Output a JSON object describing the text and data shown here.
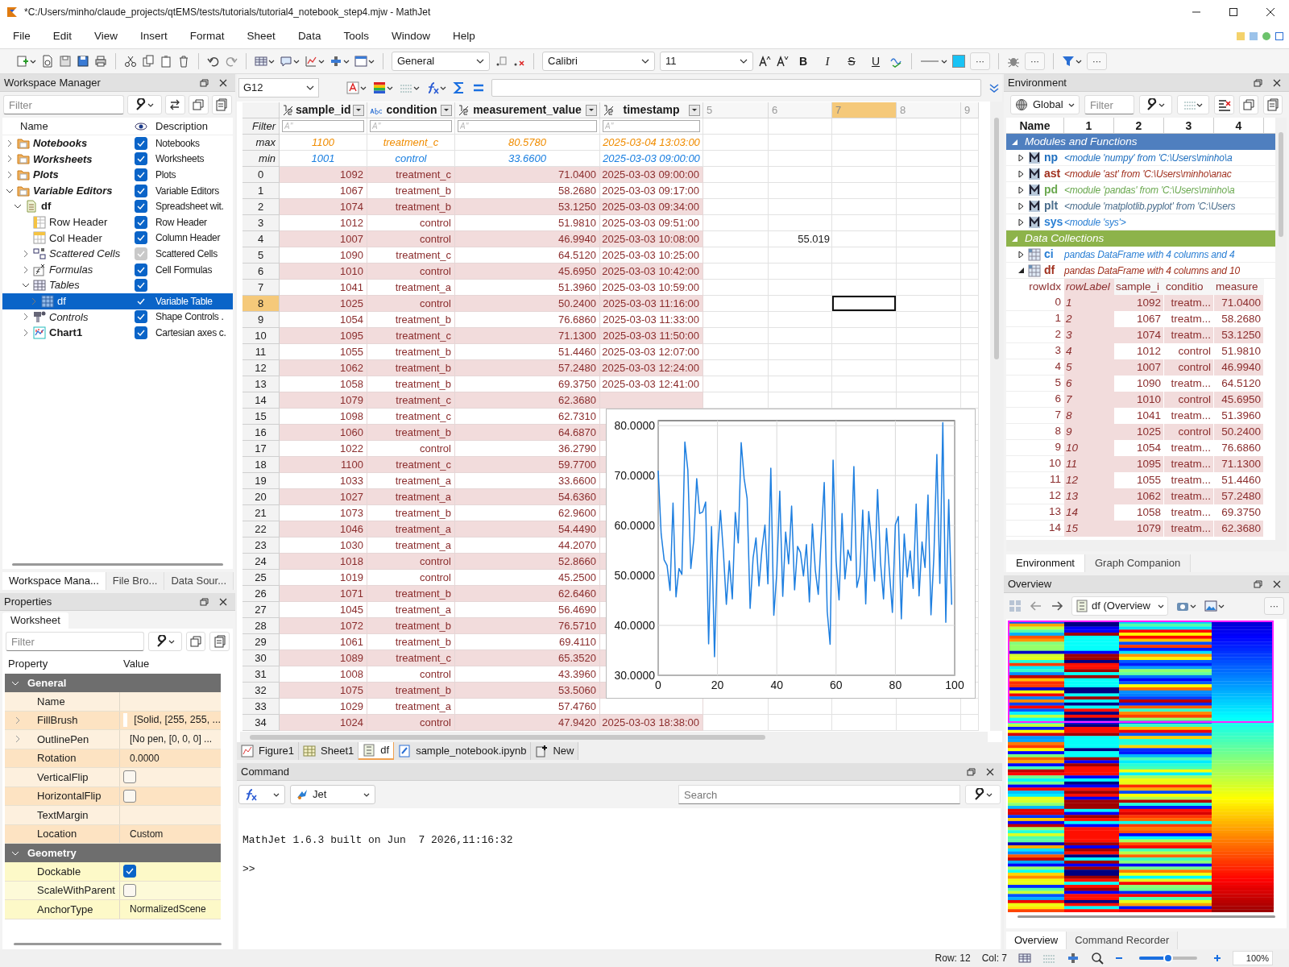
{
  "window": {
    "title": "*C:/Users/minho/claude_projects/qtEMS/tests/tutorials/tutorial4_notebook_step4.mjw - MathJet"
  },
  "menu": [
    "File",
    "Edit",
    "View",
    "Insert",
    "Format",
    "Sheet",
    "Data",
    "Tools",
    "Window",
    "Help"
  ],
  "toolbar": {
    "number_format": "General",
    "font": "Calibri",
    "font_size": "11",
    "format_buttons": [
      "B",
      "I",
      "S",
      "U"
    ],
    "more_buttons": [
      "···",
      "···",
      "···"
    ]
  },
  "workspace_manager": {
    "title": "Workspace Manager",
    "filter_placeholder": "Filter",
    "columns": [
      "Name",
      "Description"
    ],
    "tree": [
      {
        "name": "Notebooks",
        "kind": "folder",
        "expanded": false,
        "checked": true,
        "disabled": false,
        "selected": false,
        "description": "Notebooks"
      },
      {
        "name": "Worksheets",
        "kind": "folder",
        "expanded": false,
        "checked": true,
        "disabled": false,
        "selected": false,
        "description": "Worksheets"
      },
      {
        "name": "Plots",
        "kind": "folder",
        "expanded": false,
        "checked": true,
        "disabled": false,
        "selected": false,
        "description": "Plots"
      },
      {
        "name": "Variable Editors",
        "kind": "folder",
        "expanded": true,
        "checked": true,
        "disabled": false,
        "selected": false,
        "description": "Variable Editors",
        "children": [
          {
            "name": "df",
            "kind": "spreadsheet",
            "expanded": true,
            "checked": true,
            "disabled": false,
            "selected": false,
            "description": "Spreadsheet wit.",
            "children": [
              {
                "name": "Row Header",
                "kind": "row-header",
                "checked": true,
                "disabled": false,
                "selected": false,
                "description": "Row Header"
              },
              {
                "name": "Col Header",
                "kind": "col-header",
                "checked": true,
                "disabled": false,
                "selected": false,
                "description": "Column Header"
              },
              {
                "name": "Scattered Cells",
                "kind": "scatter",
                "expanded": false,
                "checked": true,
                "disabled": true,
                "selected": false,
                "description": "Scattered Cells"
              },
              {
                "name": "Formulas",
                "kind": "formula",
                "expanded": false,
                "checked": true,
                "disabled": false,
                "selected": false,
                "description": "Cell Formulas"
              },
              {
                "name": "Tables",
                "kind": "table",
                "expanded": true,
                "checked": true,
                "disabled": false,
                "selected": false,
                "children": [
                  {
                    "name": "df",
                    "kind": "table-blue",
                    "expanded": false,
                    "checked": true,
                    "disabled": false,
                    "selected": true,
                    "description": "Variable Table"
                  }
                ]
              },
              {
                "name": "Controls",
                "kind": "controls",
                "expanded": false,
                "checked": true,
                "disabled": false,
                "selected": false,
                "description": "Shape Controls ."
              },
              {
                "name": "Chart1",
                "kind": "chart",
                "expanded": false,
                "checked": true,
                "disabled": false,
                "selected": false,
                "description": "Cartesian axes c."
              }
            ]
          }
        ]
      }
    ],
    "tabs": [
      {
        "label": "Workspace Mana...",
        "selected": true
      },
      {
        "label": "File Bro...",
        "selected": false
      },
      {
        "label": "Data Sour...",
        "selected": false
      }
    ]
  },
  "properties": {
    "title": "Properties",
    "tab": "Worksheet",
    "filter_placeholder": "Filter",
    "columns": [
      "Property",
      "Value"
    ],
    "groups": [
      {
        "title": "General",
        "expanded": true,
        "rows": [
          {
            "name": "Name",
            "kind": "text",
            "expandable": false
          },
          {
            "name": "FillBrush",
            "kind": "color",
            "color": "#ffffff",
            "value": "[Solid, [255, 255, ...",
            "expandable": true
          },
          {
            "name": "OutlinePen",
            "kind": "text",
            "value": "[No pen, [0, 0, 0] ...",
            "expandable": true
          },
          {
            "name": "Rotation",
            "kind": "text",
            "value": "0.0000",
            "expandable": false
          },
          {
            "name": "VerticalFlip",
            "kind": "checkbox",
            "checked": false,
            "expandable": false
          },
          {
            "name": "HorizontalFlip",
            "kind": "checkbox",
            "checked": false,
            "expandable": false
          },
          {
            "name": "TextMargin",
            "kind": "text",
            "expandable": false
          },
          {
            "name": "Location",
            "kind": "text",
            "value": "Custom",
            "expandable": false
          }
        ]
      },
      {
        "title": "Geometry",
        "expanded": true,
        "rows": [
          {
            "name": "Dockable",
            "kind": "checkbox",
            "checked": true,
            "expandable": false
          },
          {
            "name": "ScaleWithParent",
            "kind": "checkbox",
            "checked": false,
            "expandable": false
          },
          {
            "name": "AnchorType",
            "kind": "text",
            "value": "NormalizedScene",
            "expandable": false
          }
        ]
      }
    ]
  },
  "sheet": {
    "cell_ref": "G12",
    "columns": [
      {
        "label": "sample_id",
        "kind": "number",
        "selected": false
      },
      {
        "label": "condition",
        "kind": "text",
        "selected": false
      },
      {
        "label": "measurement_value",
        "kind": "number",
        "selected": false
      },
      {
        "label": "timestamp",
        "kind": "number",
        "selected": false
      },
      {
        "label": "5",
        "kind": "empty",
        "selected": false
      },
      {
        "label": "6",
        "kind": "empty",
        "selected": false
      },
      {
        "label": "7",
        "kind": "empty",
        "selected": true
      },
      {
        "label": "8",
        "kind": "empty",
        "selected": false
      },
      {
        "label": "9",
        "kind": "empty",
        "selected": false
      }
    ],
    "filter_label": "Filter",
    "filter_placeholders": [
      "A''",
      "A''",
      "A''",
      "A''"
    ],
    "stats": [
      {
        "label": "max",
        "kind": "max",
        "values": [
          "1100",
          "treatment_c",
          "80.5780",
          "2025-03-04 13:03:00"
        ]
      },
      {
        "label": "min",
        "kind": "min",
        "values": [
          "1001",
          "control",
          "33.6600",
          "2025-03-03 09:00:00"
        ]
      }
    ],
    "rows": [
      {
        "index": "0",
        "selected": false,
        "values": [
          "1092",
          "treatment_c",
          "71.0400",
          "2025-03-03 09:00:00"
        ]
      },
      {
        "index": "1",
        "selected": false,
        "values": [
          "1067",
          "treatment_b",
          "58.2680",
          "2025-03-03 09:17:00"
        ]
      },
      {
        "index": "2",
        "selected": false,
        "values": [
          "1074",
          "treatment_b",
          "53.1250",
          "2025-03-03 09:34:00"
        ]
      },
      {
        "index": "3",
        "selected": false,
        "values": [
          "1012",
          "control",
          "51.9810",
          "2025-03-03 09:51:00"
        ]
      },
      {
        "index": "4",
        "selected": false,
        "values": [
          "1007",
          "control",
          "46.9940",
          "2025-03-03 10:08:00"
        ],
        "column_6": "55.019"
      },
      {
        "index": "5",
        "selected": false,
        "values": [
          "1090",
          "treatment_c",
          "64.5120",
          "2025-03-03 10:25:00"
        ]
      },
      {
        "index": "6",
        "selected": false,
        "values": [
          "1010",
          "control",
          "45.6950",
          "2025-03-03 10:42:00"
        ]
      },
      {
        "index": "7",
        "selected": false,
        "values": [
          "1041",
          "treatment_a",
          "51.3960",
          "2025-03-03 10:59:00"
        ]
      },
      {
        "index": "8",
        "selected": true,
        "values": [
          "1025",
          "control",
          "50.2400",
          "2025-03-03 11:16:00"
        ]
      },
      {
        "index": "9",
        "selected": false,
        "values": [
          "1054",
          "treatment_b",
          "76.6860",
          "2025-03-03 11:33:00"
        ]
      },
      {
        "index": "10",
        "selected": false,
        "values": [
          "1095",
          "treatment_c",
          "71.1300",
          "2025-03-03 11:50:00"
        ]
      },
      {
        "index": "11",
        "selected": false,
        "values": [
          "1055",
          "treatment_b",
          "51.4460",
          "2025-03-03 12:07:00"
        ]
      },
      {
        "index": "12",
        "selected": false,
        "values": [
          "1062",
          "treatment_b",
          "57.2480",
          "2025-03-03 12:24:00"
        ]
      },
      {
        "index": "13",
        "selected": false,
        "values": [
          "1058",
          "treatment_b",
          "69.3750",
          "2025-03-03 12:41:00"
        ]
      },
      {
        "index": "14",
        "selected": false,
        "values": [
          "1079",
          "treatment_c",
          "62.3680"
        ]
      },
      {
        "index": "15",
        "selected": false,
        "values": [
          "1098",
          "treatment_c",
          "62.7310"
        ]
      },
      {
        "index": "16",
        "selected": false,
        "values": [
          "1060",
          "treatment_b",
          "64.6870"
        ]
      },
      {
        "index": "17",
        "selected": false,
        "values": [
          "1022",
          "control",
          "36.2790"
        ]
      },
      {
        "index": "18",
        "selected": false,
        "values": [
          "1100",
          "treatment_c",
          "59.7700"
        ]
      },
      {
        "index": "19",
        "selected": false,
        "values": [
          "1033",
          "treatment_a",
          "33.6600"
        ]
      },
      {
        "index": "20",
        "selected": false,
        "values": [
          "1027",
          "treatment_a",
          "54.6360"
        ]
      },
      {
        "index": "21",
        "selected": false,
        "values": [
          "1073",
          "treatment_b",
          "62.9600"
        ]
      },
      {
        "index": "22",
        "selected": false,
        "values": [
          "1046",
          "treatment_a",
          "54.4490"
        ]
      },
      {
        "index": "23",
        "selected": false,
        "values": [
          "1030",
          "treatment_a",
          "44.2070"
        ]
      },
      {
        "index": "24",
        "selected": false,
        "values": [
          "1018",
          "control",
          "52.8660"
        ]
      },
      {
        "index": "25",
        "selected": false,
        "values": [
          "1019",
          "control",
          "45.2500"
        ]
      },
      {
        "index": "26",
        "selected": false,
        "values": [
          "1071",
          "treatment_b",
          "62.6460"
        ]
      },
      {
        "index": "27",
        "selected": false,
        "values": [
          "1045",
          "treatment_a",
          "56.4690"
        ]
      },
      {
        "index": "28",
        "selected": false,
        "values": [
          "1072",
          "treatment_b",
          "76.5710"
        ]
      },
      {
        "index": "29",
        "selected": false,
        "values": [
          "1061",
          "treatment_b",
          "69.4110"
        ]
      },
      {
        "index": "30",
        "selected": false,
        "values": [
          "1089",
          "treatment_c",
          "65.3520"
        ]
      },
      {
        "index": "31",
        "selected": false,
        "values": [
          "1008",
          "control",
          "43.3960"
        ]
      },
      {
        "index": "32",
        "selected": false,
        "values": [
          "1075",
          "treatment_b",
          "53.5060"
        ]
      },
      {
        "index": "33",
        "selected": false,
        "values": [
          "1029",
          "treatment_a",
          "57.4760"
        ]
      },
      {
        "index": "34",
        "selected": false,
        "values": [
          "1024",
          "control",
          "47.9420",
          "2025-03-03 18:38:00"
        ]
      }
    ],
    "chart": {
      "chart_data": {
        "type": "line",
        "xlim": [
          0,
          100
        ],
        "ylim": [
          30,
          81
        ],
        "grid": true,
        "x": [
          0,
          1,
          2,
          3,
          4,
          5,
          6,
          7,
          8,
          9,
          10,
          11,
          12,
          13,
          14,
          15,
          16,
          17,
          18,
          19,
          20,
          21,
          22,
          23,
          24,
          25,
          26,
          27,
          28,
          29,
          30,
          31,
          32,
          33,
          34,
          35,
          36,
          37,
          38,
          39,
          40,
          41,
          42,
          43,
          44,
          45,
          46,
          47,
          48,
          49,
          50,
          51,
          52,
          53,
          54,
          55,
          56,
          57,
          58,
          59,
          60,
          61,
          62,
          63,
          64,
          65,
          66,
          67,
          68,
          69,
          70,
          71,
          72,
          73,
          74,
          75,
          76,
          77,
          78,
          79,
          80,
          81,
          82,
          83,
          84,
          85,
          86,
          87,
          88,
          89,
          90,
          91,
          92,
          93,
          94,
          95,
          96,
          97,
          98,
          99
        ],
        "series": [
          {
            "color": "#1e7fe0",
            "values": [
              71.0,
              58.3,
              53.1,
              52.0,
              47.0,
              64.5,
              45.7,
              51.4,
              50.2,
              76.7,
              71.1,
              51.4,
              57.2,
              69.4,
              62.4,
              62.7,
              64.7,
              36.3,
              59.8,
              33.7,
              54.6,
              63.0,
              54.4,
              44.2,
              52.9,
              45.3,
              62.6,
              56.5,
              76.6,
              69.4,
              65.4,
              43.4,
              53.5,
              57.5,
              47.9,
              55.2,
              60.1,
              48.3,
              71.5,
              42.0,
              50.5,
              66.9,
              45.8,
              58.7,
              52.3,
              63.9,
              47.1,
              55.8,
              54.6,
              49.9,
              56.2,
              44.7,
              60.3,
              51.1,
              46.2,
              57.9,
              68.6,
              42.8,
              36.2,
              73.1,
              52.9,
              45.1,
              62.4,
              49.3,
              55.1,
              53.0,
              71.8,
              47.6,
              50.2,
              63.1,
              44.3,
              62.8,
              56.4,
              48.9,
              67.2,
              52.5,
              45.3,
              59.4,
              50.8,
              42.6,
              60.2,
              61.8,
              41.3,
              58.3,
              49.7,
              54.9,
              47.4,
              64.3,
              45.9,
              56.7,
              51.6,
              66.1,
              42.1,
              53.8,
              74.2,
              48.4,
              80.6,
              40.6,
              65.2,
              44.1
            ]
          }
        ],
        "xticks": [
          0,
          20,
          40,
          60,
          80,
          100
        ],
        "yticks": [
          {
            "value": 30,
            "label": "30.0000"
          },
          {
            "value": 40,
            "label": "40.0000"
          },
          {
            "value": 50,
            "label": "50.0000"
          },
          {
            "value": 60,
            "label": "60.0000"
          },
          {
            "value": 70,
            "label": "70.0000"
          },
          {
            "value": 80,
            "label": "80.0000"
          }
        ]
      }
    },
    "tabs": [
      {
        "label": "Figure1",
        "kind": "figure",
        "selected": false
      },
      {
        "label": "Sheet1",
        "kind": "sheet",
        "selected": false
      },
      {
        "label": "df",
        "kind": "dataframe",
        "selected": true
      },
      {
        "label": "sample_notebook.ipynb",
        "kind": "notebook",
        "selected": false
      },
      {
        "label": "New",
        "kind": "new",
        "selected": false
      }
    ]
  },
  "command": {
    "title": "Command",
    "engine": "Jet",
    "search_placeholder": "Search",
    "output": [
      "MathJet 1.6.3 built on Jun  7 2026,11:16:32",
      ">>"
    ]
  },
  "environment": {
    "title": "Environment",
    "scope": "Global",
    "filter_placeholder": "Filter",
    "columns": [
      "Name",
      "1",
      "2",
      "3",
      "4"
    ],
    "groups": [
      {
        "title": "Modules and Functions",
        "kind": "modules",
        "expanded": true,
        "items": [
          {
            "name": "np",
            "color": "#1f6fbf",
            "description": "<module 'numpy' from 'C:\\Users\\minho\\a",
            "expanded": false
          },
          {
            "name": "ast",
            "color": "#a0301e",
            "description": "<module 'ast' from 'C:\\Users\\minho\\anac",
            "expanded": false
          },
          {
            "name": "pd",
            "color": "#6aa84f",
            "description": "<module 'pandas' from 'C:\\Users\\minho\\a",
            "expanded": false
          },
          {
            "name": "plt",
            "color": "#4a6d8c",
            "description": "<module 'matplotlib.pyplot' from 'C:\\Users",
            "expanded": false
          },
          {
            "name": "sys",
            "color": "#2a7fd4",
            "description": "<module 'sys'>",
            "expanded": false
          }
        ]
      },
      {
        "title": "Data Collections",
        "kind": "data",
        "expanded": true,
        "items": [
          {
            "name": "ci",
            "color": "#2a7fd4",
            "description": "pandas DataFrame with 4 columns and 4",
            "expanded": false
          },
          {
            "name": "df",
            "color": "#a0301e",
            "description": "pandas DataFrame with 4 columns and 10",
            "expanded": true
          }
        ]
      }
    ],
    "df_preview": {
      "columns": [
        "rowIdx",
        "rowLabel",
        "sample_i",
        "conditio",
        "measure"
      ],
      "rows": [
        [
          "0",
          "1",
          "1092",
          "treatm...",
          "71.0400"
        ],
        [
          "1",
          "2",
          "1067",
          "treatm...",
          "58.2680"
        ],
        [
          "2",
          "3",
          "1074",
          "treatm...",
          "53.1250"
        ],
        [
          "3",
          "4",
          "1012",
          "control",
          "51.9810"
        ],
        [
          "4",
          "5",
          "1007",
          "control",
          "46.9940"
        ],
        [
          "5",
          "6",
          "1090",
          "treatm...",
          "64.5120"
        ],
        [
          "6",
          "7",
          "1010",
          "control",
          "45.6950"
        ],
        [
          "7",
          "8",
          "1041",
          "treatm...",
          "51.3960"
        ],
        [
          "8",
          "9",
          "1025",
          "control",
          "50.2400"
        ],
        [
          "9",
          "10",
          "1054",
          "treatm...",
          "76.6860"
        ],
        [
          "10",
          "11",
          "1095",
          "treatm...",
          "71.1300"
        ],
        [
          "11",
          "12",
          "1055",
          "treatm...",
          "51.4460"
        ],
        [
          "12",
          "13",
          "1062",
          "treatm...",
          "57.2480"
        ],
        [
          "13",
          "14",
          "1058",
          "treatm...",
          "69.3750"
        ],
        [
          "14",
          "15",
          "1079",
          "treatm...",
          "62.3680"
        ]
      ]
    },
    "tabs": [
      {
        "label": "Environment",
        "selected": true
      },
      {
        "label": "Graph Companion",
        "selected": false
      }
    ]
  },
  "overview": {
    "title": "Overview",
    "source": "df (Overview",
    "more": "···",
    "tabs": [
      {
        "label": "Overview",
        "selected": true
      },
      {
        "label": "Command Recorder",
        "selected": false
      }
    ]
  },
  "status_bar": {
    "row": "Row: 12",
    "col": "Col: 7",
    "zoom": {
      "level": 0.5
    },
    "zoom_text": "100%"
  }
}
